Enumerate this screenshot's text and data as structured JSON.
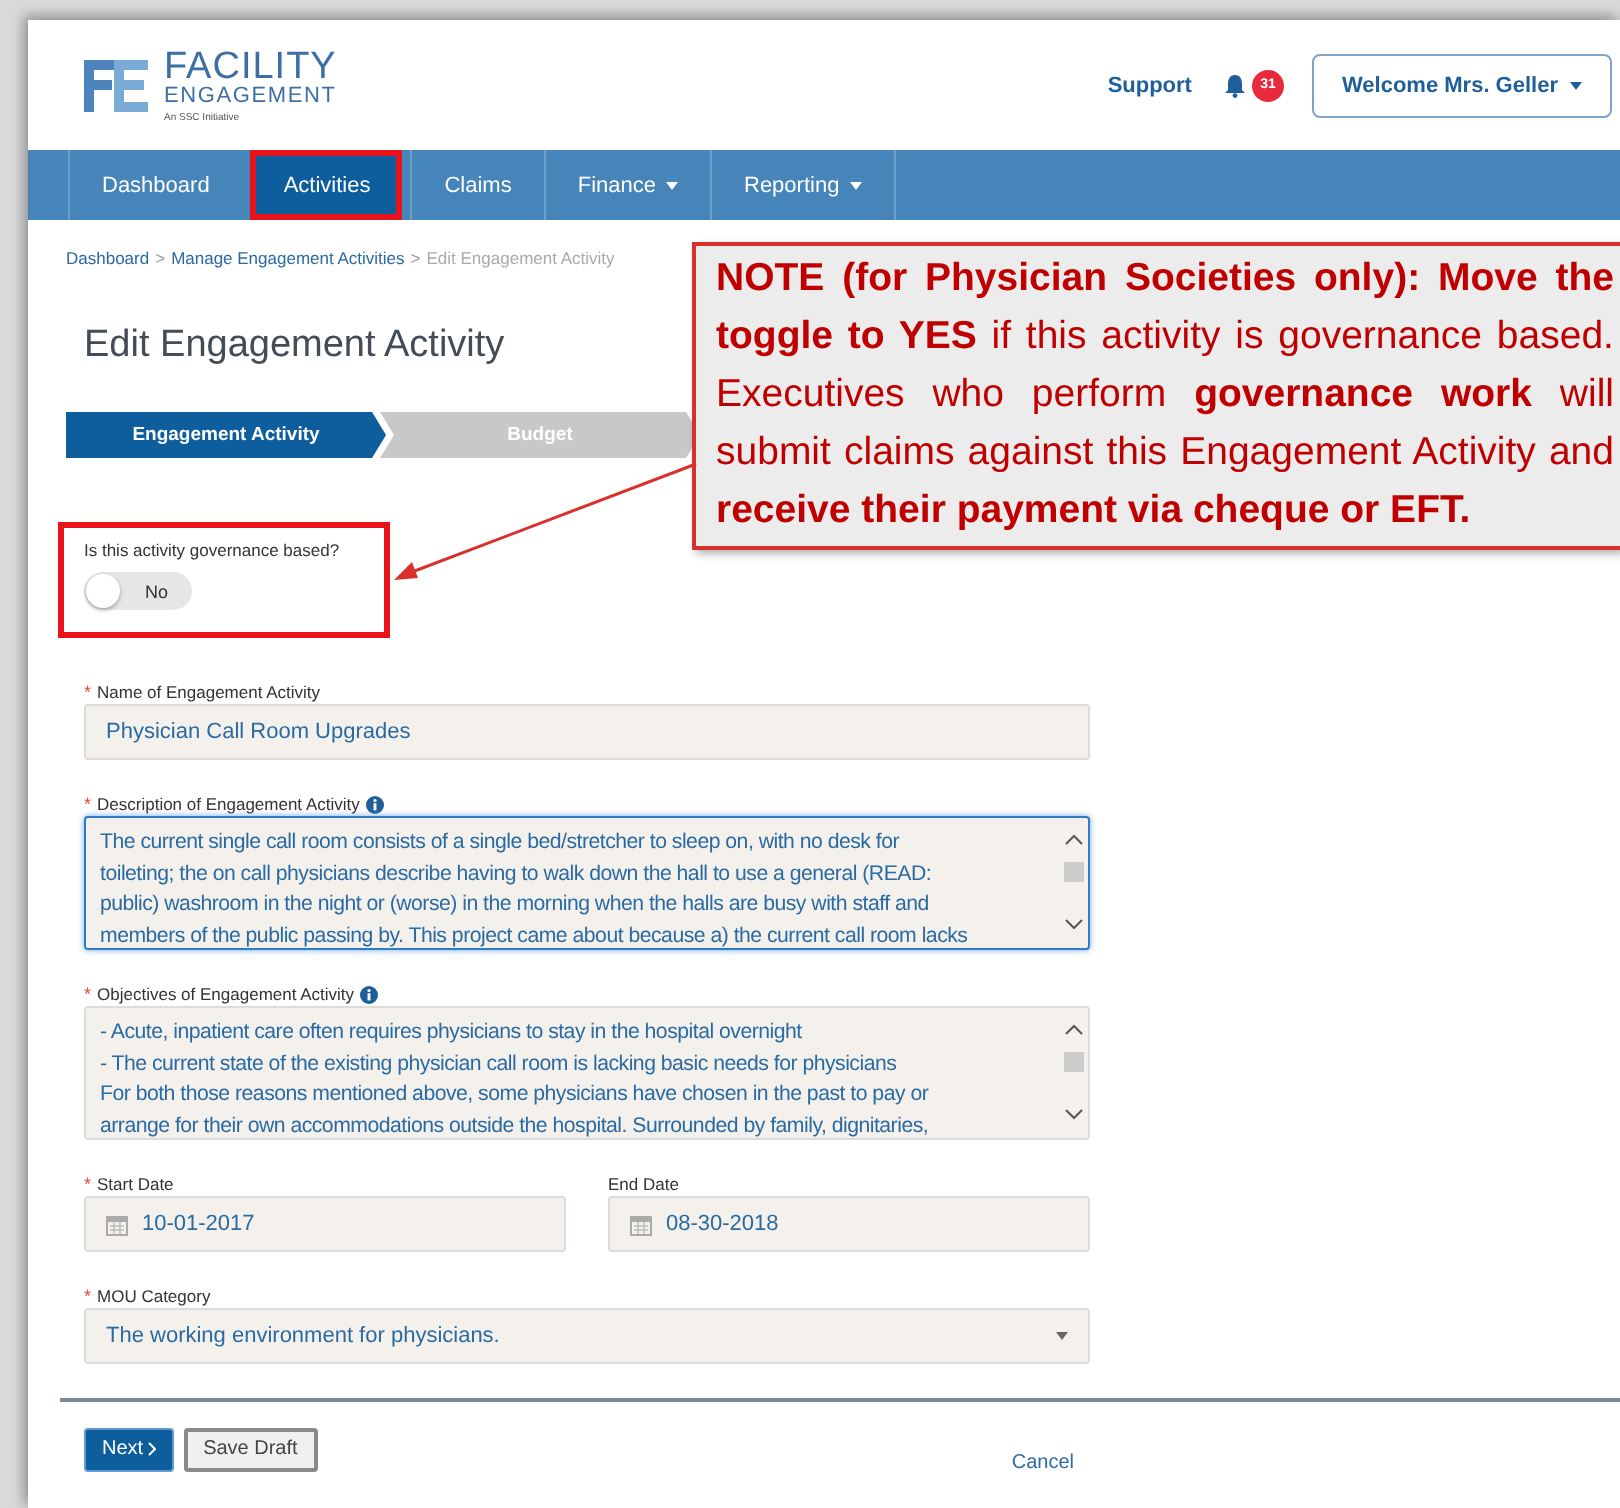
{
  "header": {
    "logo": {
      "title": "FACILITY",
      "subtitle": "ENGAGEMENT",
      "tagline": "An SSC Initiative"
    },
    "support": "Support",
    "notification_count": "31",
    "user_menu": "Welcome Mrs. Geller"
  },
  "nav": [
    {
      "label": "Dashboard",
      "selected": false,
      "dropdown": false,
      "highlighted": false
    },
    {
      "label": "Activities",
      "selected": true,
      "dropdown": false,
      "highlighted": true
    },
    {
      "label": "Claims",
      "selected": false,
      "dropdown": false,
      "highlighted": false
    },
    {
      "label": "Finance",
      "selected": false,
      "dropdown": true,
      "highlighted": false
    },
    {
      "label": "Reporting",
      "selected": false,
      "dropdown": true,
      "highlighted": false
    }
  ],
  "breadcrumb": [
    {
      "label": "Dashboard",
      "current": false
    },
    {
      "separator": ">",
      "label": "Manage Engagement Activities",
      "current": false
    },
    {
      "separator": ">",
      "label": "Edit Engagement Activity",
      "current": true
    }
  ],
  "page_title": "Edit Engagement Activity",
  "steps": [
    {
      "label": "Engagement Activity",
      "selected": true
    },
    {
      "label": "Budget",
      "selected": false
    }
  ],
  "governance": {
    "label": "Is this activity governance based?",
    "value": "No",
    "on": false,
    "highlighted": true
  },
  "fields": [
    {
      "kind": "input",
      "required_mark": "*",
      "label": "Name of Engagement Activity",
      "value": "Physician Call Room Upgrades"
    },
    {
      "kind": "textarea",
      "required_mark": "*",
      "label": "Description of Engagement Activity",
      "info": true,
      "focused": true,
      "lines": [
        "The current single call room consists of a single bed/stretcher to sleep on, with no desk for",
        "toileting; the on call physicians describe having to walk down the hall to use a general (READ:",
        "public) washroom in the night or (worse) in the morning when the halls are busy with staff and",
        "members of the public passing by. This project came about because a) the current call room lacks"
      ]
    },
    {
      "kind": "textarea",
      "required_mark": "*",
      "label": "Objectives of Engagement Activity",
      "info": true,
      "focused": false,
      "lines": [
        "- Acute, inpatient care often requires physicians to stay in the hospital overnight",
        "- The current state of the existing physician call room is lacking basic needs for physicians",
        "For both those reasons mentioned above, some physicians have chosen in the past to pay or",
        "arrange for their own accommodations outside the hospital. Surrounded by family, dignitaries,"
      ]
    },
    {
      "kind": "date",
      "required_mark": "*",
      "label": "Start Date",
      "value": "10-01-2017"
    },
    {
      "kind": "date",
      "label": "End Date",
      "value": "08-30-2018"
    },
    {
      "kind": "select",
      "required_mark": "*",
      "label": "MOU Category",
      "value": "The working environment for physicians."
    }
  ],
  "buttons": [
    {
      "label": "Next",
      "kind": "primary"
    },
    {
      "label": "Save Draft",
      "kind": "secondary"
    }
  ],
  "cancel": "Cancel",
  "annotation": {
    "text": "**NOTE (for Physician Societies only): Move the toggle to YES** if this activity is governance based. Executives who perform **governance work** will submit claims against this Engagement Activity and **receive their payment via cheque or EFT.**"
  }
}
